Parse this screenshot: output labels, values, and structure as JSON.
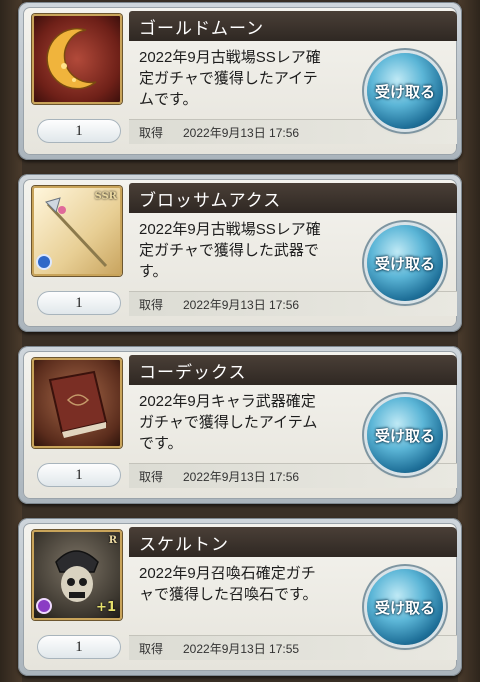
{
  "items": [
    {
      "name": "ゴールドムーン",
      "description_lines": [
        "2022年9月古戦場SSレア確",
        "定ガチャで獲得したアイテ",
        "ムです。"
      ],
      "count": "1",
      "received_label": "取得",
      "received_date": "2022年9月13日 17:56",
      "button_label": "受け取る",
      "icon": "gold-moon-icon"
    },
    {
      "name": "ブロッサムアクス",
      "description_lines": [
        "2022年9月古戦場SSレア確",
        "定ガチャで獲得した武器で",
        "す。"
      ],
      "count": "1",
      "received_label": "取得",
      "received_date": "2022年9月13日 17:56",
      "button_label": "受け取る",
      "rarity": "SSR",
      "icon": "blossom-axe-icon"
    },
    {
      "name": "コーデックス",
      "description_lines": [
        "2022年9月キャラ武器確定",
        "ガチャで獲得したアイテム",
        "です。"
      ],
      "count": "1",
      "received_label": "取得",
      "received_date": "2022年9月13日 17:56",
      "button_label": "受け取る",
      "icon": "codex-book-icon"
    },
    {
      "name": "スケルトン",
      "description_lines": [
        "2022年9月召喚石確定ガチ",
        "ャで獲得した召喚石です。"
      ],
      "count": "1",
      "received_label": "取得",
      "received_date": "2022年9月13日 17:55",
      "button_label": "受け取る",
      "rarity": "R",
      "bonus": "+1",
      "icon": "skeleton-summon-icon"
    }
  ]
}
